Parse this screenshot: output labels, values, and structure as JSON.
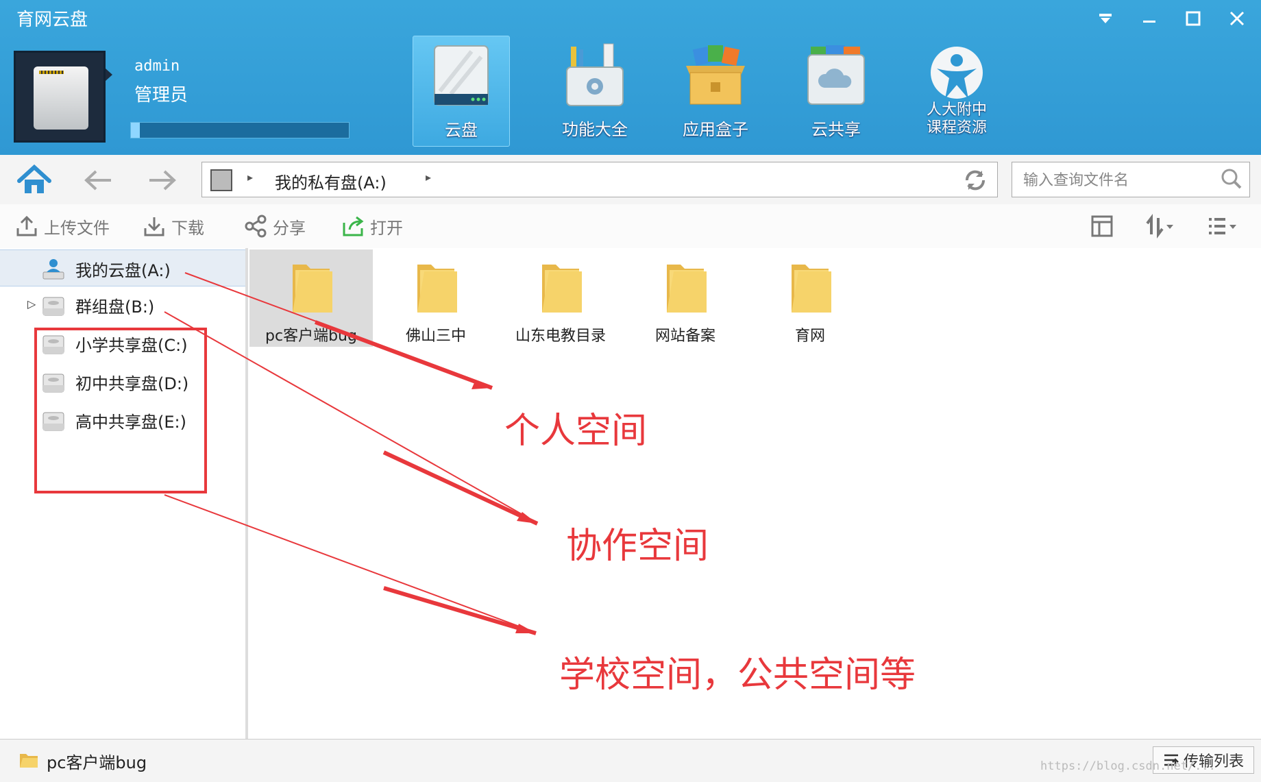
{
  "window": {
    "title": "育网云盘",
    "controls": [
      "dropdown-icon",
      "minimize-icon",
      "maximize-icon",
      "close-icon"
    ]
  },
  "user": {
    "name": "admin",
    "role": "管理员",
    "quota_fraction": 0.04
  },
  "apps": [
    {
      "label": "云盘",
      "icon": "cloud-disk-icon",
      "active": true
    },
    {
      "label": "功能大全",
      "icon": "toolbox-icon",
      "active": false
    },
    {
      "label": "应用盒子",
      "icon": "app-box-icon",
      "active": false
    },
    {
      "label": "云共享",
      "icon": "cloud-share-icon",
      "active": false
    },
    {
      "label_line1": "人大附中",
      "label_line2": "课程资源",
      "icon": "course-resource-icon",
      "active": false
    }
  ],
  "address": {
    "path": "我的私有盘(A:)",
    "search_placeholder": "输入查询文件名"
  },
  "toolbar": {
    "upload": "上传文件",
    "download": "下载",
    "share": "分享",
    "open": "打开"
  },
  "tree": [
    {
      "label": "我的云盘(A:)",
      "selected": true
    },
    {
      "label": "群组盘(B:)",
      "expandable": true
    },
    {
      "label": "小学共享盘(C:)"
    },
    {
      "label": "初中共享盘(D:)"
    },
    {
      "label": "高中共享盘(E:)"
    }
  ],
  "files": [
    {
      "name": "pc客户端bug",
      "selected": true
    },
    {
      "name": "佛山三中"
    },
    {
      "name": "山东电教目录"
    },
    {
      "name": "网站备案"
    },
    {
      "name": "育网"
    }
  ],
  "status": {
    "selected_item": "pc客户端bug",
    "transfer_button": "传输列表",
    "watermark": "https://blog.csdn.net/..."
  },
  "annotations": {
    "personal": "个人空间",
    "collab": "协作空间",
    "school": "学校空间，公共空间等"
  },
  "colors": {
    "header": "#3aa6dc",
    "annotation": "#e8383c",
    "folder": "#f6d36a"
  }
}
